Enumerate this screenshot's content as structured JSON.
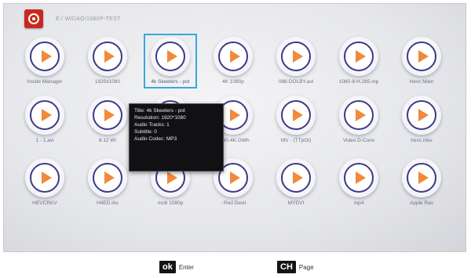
{
  "header": {
    "logo_icon": "media-player-logo-icon",
    "path": "E:/  WIDAO/1080P-TEST"
  },
  "tile_icon": "play-icon",
  "rows": [
    {
      "trailing": "",
      "tiles": [
        {
          "label": "Inside Manager"
        },
        {
          "label": "1920x1080"
        },
        {
          "label": "4k Skeeters - pot",
          "selected": true
        },
        {
          "label": "4K  1080p"
        },
        {
          "label": "088-DOLBY.avi"
        },
        {
          "label": "1080-8-H.265.mp"
        },
        {
          "label": "Hevc Main"
        }
      ]
    },
    {
      "trailing": "",
      "tiles": [
        {
          "label": "1  -  1.avi"
        },
        {
          "label": "8.12  Wi"
        },
        {
          "label": ""
        },
        {
          "label": "1080-4K.OWh"
        },
        {
          "label": "MV  -  (TTpOI)"
        },
        {
          "label": "Video D-Conv"
        },
        {
          "label": "hevc.mkv"
        }
      ]
    },
    {
      "trailing": "",
      "tiles": [
        {
          "label": "HEVCRKV"
        },
        {
          "label": "H4ED.rkv"
        },
        {
          "label": "mob 1080p"
        },
        {
          "label": "- Red Devil"
        },
        {
          "label": "MYDVI"
        },
        {
          "label": "mp4"
        },
        {
          "label": "Apple Ras"
        }
      ]
    }
  ],
  "info_popup": {
    "lines": [
      "Title: 4k Skeeters - pot",
      "Resolution: 1920*1080",
      "Audio Tracks: 1",
      "Subtitle: 0",
      "Audio Codec: MP3"
    ]
  },
  "footer": {
    "ok_key": "ok",
    "ok_label": "Enter",
    "ch_key": "CH",
    "ch_label": "Page"
  }
}
